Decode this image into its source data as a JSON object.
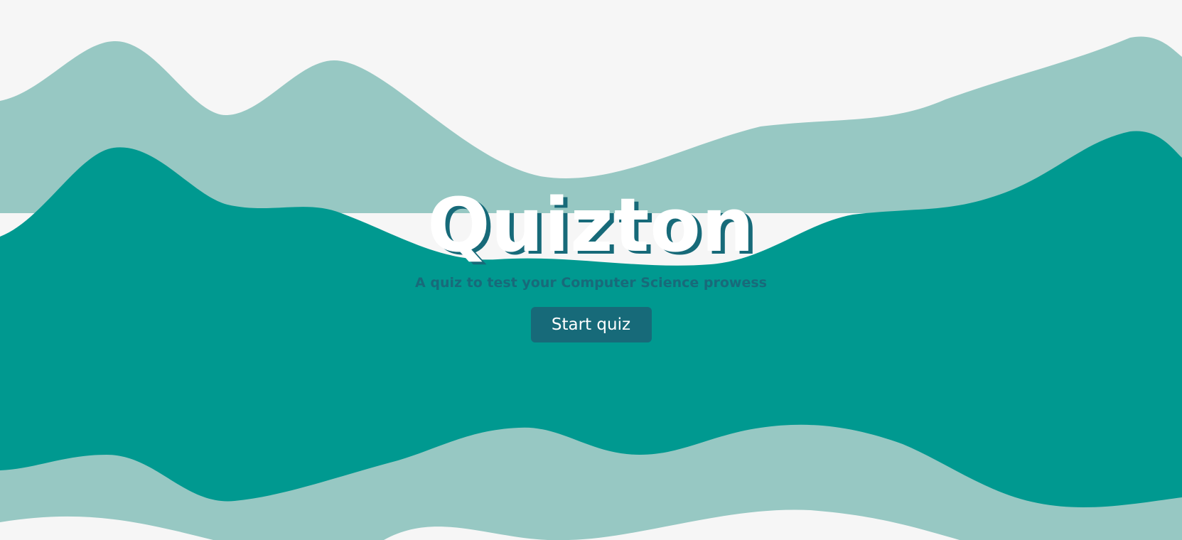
{
  "app": {
    "title": "Quizton",
    "subtitle": "A quiz to test your Computer Science prowess",
    "start_label": "Start quiz"
  },
  "colors": {
    "background": "#f6f6f6",
    "wave_light": "#97c8c3",
    "wave_dark": "#009990",
    "accent": "#176a79",
    "title_text": "#ffffff"
  }
}
